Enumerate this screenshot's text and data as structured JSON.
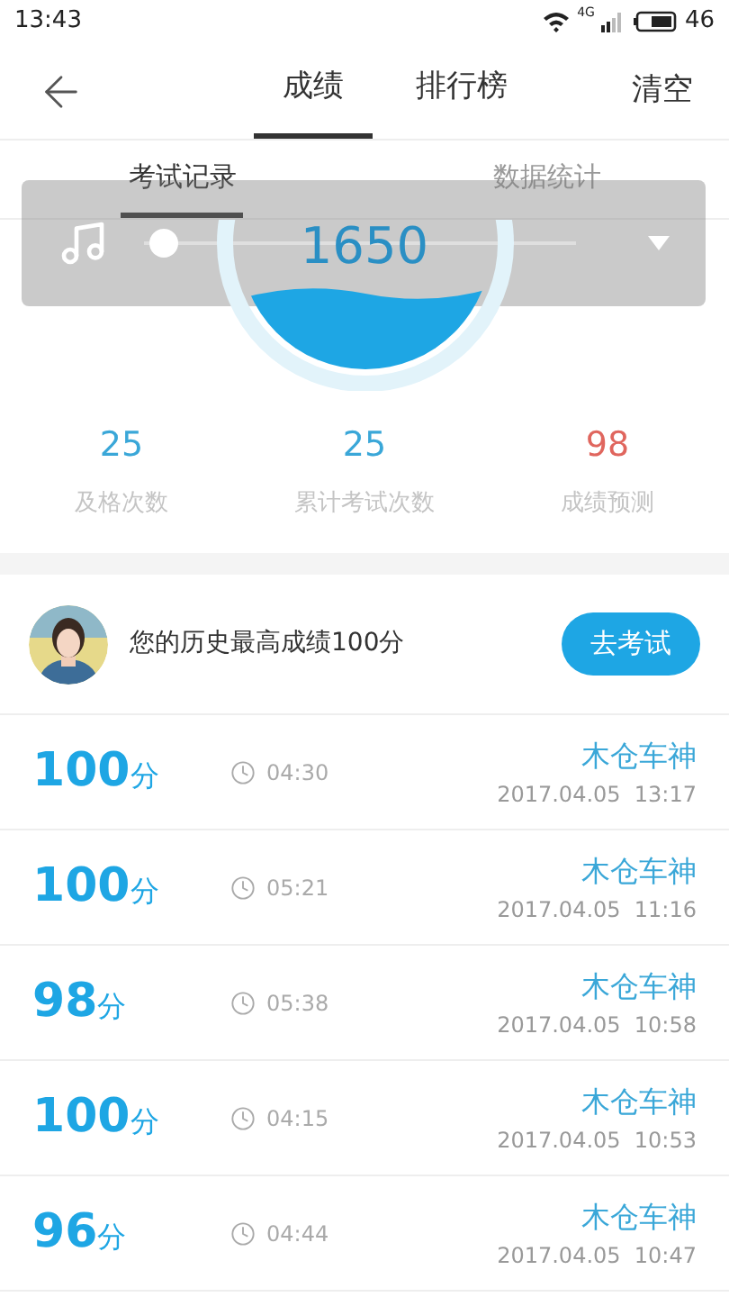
{
  "status_bar": {
    "time": "13:43",
    "network": "4G",
    "battery": "46"
  },
  "header": {
    "tabs": [
      {
        "label": "成绩",
        "selected": true
      },
      {
        "label": "排行榜",
        "selected": false
      }
    ],
    "action": "清空"
  },
  "sub_tabs": [
    {
      "label": "考试记录",
      "selected": true
    },
    {
      "label": "数据统计",
      "selected": false
    }
  ],
  "gauge": {
    "value": "1650"
  },
  "stats": [
    {
      "value": "25",
      "label": "及格次数",
      "color": "#3aa7d8"
    },
    {
      "value": "25",
      "label": "累计考试次数",
      "color": "#3aa7d8"
    },
    {
      "value": "98",
      "label": "成绩预测",
      "color": "#e0665e"
    }
  ],
  "best": {
    "text": "您的历史最高成绩100分",
    "button": "去考试"
  },
  "records": [
    {
      "score": "100",
      "unit": "分",
      "duration": "04:30",
      "name": "木仓车神",
      "date": "2017.04.05  13:17"
    },
    {
      "score": "100",
      "unit": "分",
      "duration": "05:21",
      "name": "木仓车神",
      "date": "2017.04.05  11:16"
    },
    {
      "score": "98",
      "unit": "分",
      "duration": "05:38",
      "name": "木仓车神",
      "date": "2017.04.05  10:58"
    },
    {
      "score": "100",
      "unit": "分",
      "duration": "04:15",
      "name": "木仓车神",
      "date": "2017.04.05  10:53"
    },
    {
      "score": "96",
      "unit": "分",
      "duration": "04:44",
      "name": "木仓车神",
      "date": "2017.04.05  10:47"
    }
  ],
  "player": {
    "level": 0.02
  }
}
